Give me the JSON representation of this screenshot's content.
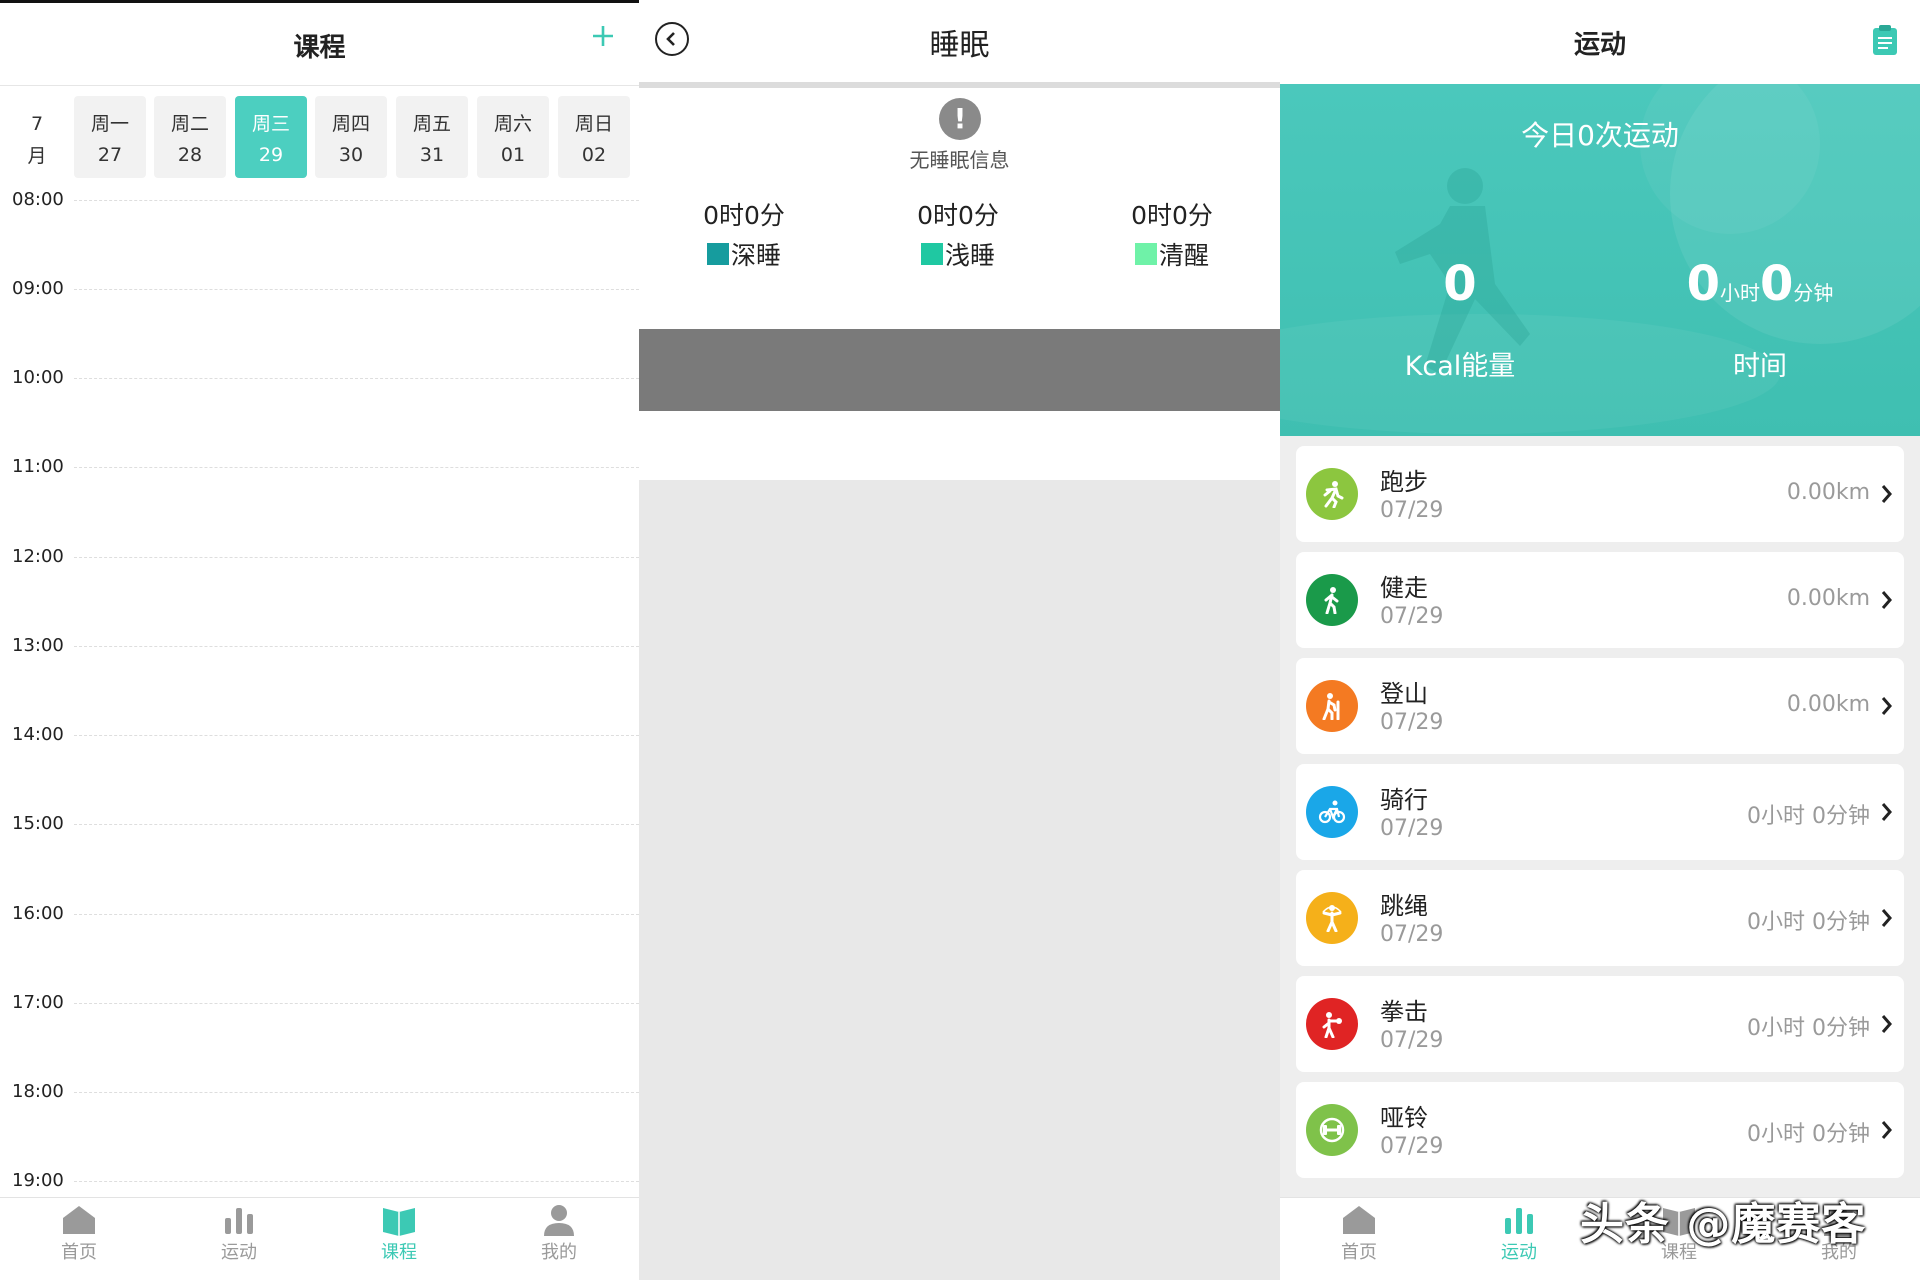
{
  "courses": {
    "title": "课程",
    "month_label": "7\n月",
    "month_num": "7",
    "month_char": "月",
    "days": [
      {
        "name": "周一",
        "date": "27",
        "selected": false
      },
      {
        "name": "周二",
        "date": "28",
        "selected": false
      },
      {
        "name": "周三",
        "date": "29",
        "selected": true
      },
      {
        "name": "周四",
        "date": "30",
        "selected": false
      },
      {
        "name": "周五",
        "date": "31",
        "selected": false
      },
      {
        "name": "周六",
        "date": "01",
        "selected": false
      },
      {
        "name": "周日",
        "date": "02",
        "selected": false
      }
    ],
    "times": [
      "08:00",
      "09:00",
      "10:00",
      "11:00",
      "12:00",
      "13:00",
      "14:00",
      "15:00",
      "16:00",
      "17:00",
      "18:00",
      "19:00"
    ],
    "tabs": [
      "首页",
      "运动",
      "课程",
      "我的"
    ],
    "active_tab": "课程"
  },
  "sleep": {
    "title": "睡眠",
    "no_info": "无睡眠信息",
    "stages": [
      {
        "value": "0时0分",
        "label": "深睡",
        "color": "#169c9e"
      },
      {
        "value": "0时0分",
        "label": "浅睡",
        "color": "#1fc8a2"
      },
      {
        "value": "0时0分",
        "label": "清醒",
        "color": "#6ff2a8"
      }
    ]
  },
  "sport": {
    "title": "运动",
    "hero_title": "今日0次运动",
    "kcal_value": "0",
    "kcal_label": "Kcal能量",
    "hours": "0",
    "hours_unit": "小时",
    "minutes": "0",
    "minutes_unit": "分钟",
    "time_label": "时间",
    "items": [
      {
        "name": "跑步",
        "date": "07/29",
        "value": "0.00km",
        "color": "#8cc63f",
        "icon": "running-icon"
      },
      {
        "name": "健走",
        "date": "07/29",
        "value": "0.00km",
        "color": "#1a9a4a",
        "icon": "walking-icon"
      },
      {
        "name": "登山",
        "date": "07/29",
        "value": "0.00km",
        "color": "#f47a22",
        "icon": "hiking-icon"
      },
      {
        "name": "骑行",
        "date": "07/29",
        "value": "0小时 0分钟",
        "color": "#1aa7e8",
        "icon": "cycling-icon"
      },
      {
        "name": "跳绳",
        "date": "07/29",
        "value": "0小时 0分钟",
        "color": "#f5b01a",
        "icon": "jump-rope-icon"
      },
      {
        "name": "拳击",
        "date": "07/29",
        "value": "0小时 0分钟",
        "color": "#e02424",
        "icon": "boxing-icon"
      },
      {
        "name": "哑铃",
        "date": "07/29",
        "value": "0小时 0分钟",
        "color": "#7fc24a",
        "icon": "dumbbell-icon"
      }
    ],
    "tabs": [
      "首页",
      "运动",
      "课程",
      "我的"
    ],
    "active_tab": "运动"
  },
  "watermark": "头条 @魔赛客",
  "colors": {
    "accent": "#3cc9b4",
    "hero": "#45c4b8"
  }
}
